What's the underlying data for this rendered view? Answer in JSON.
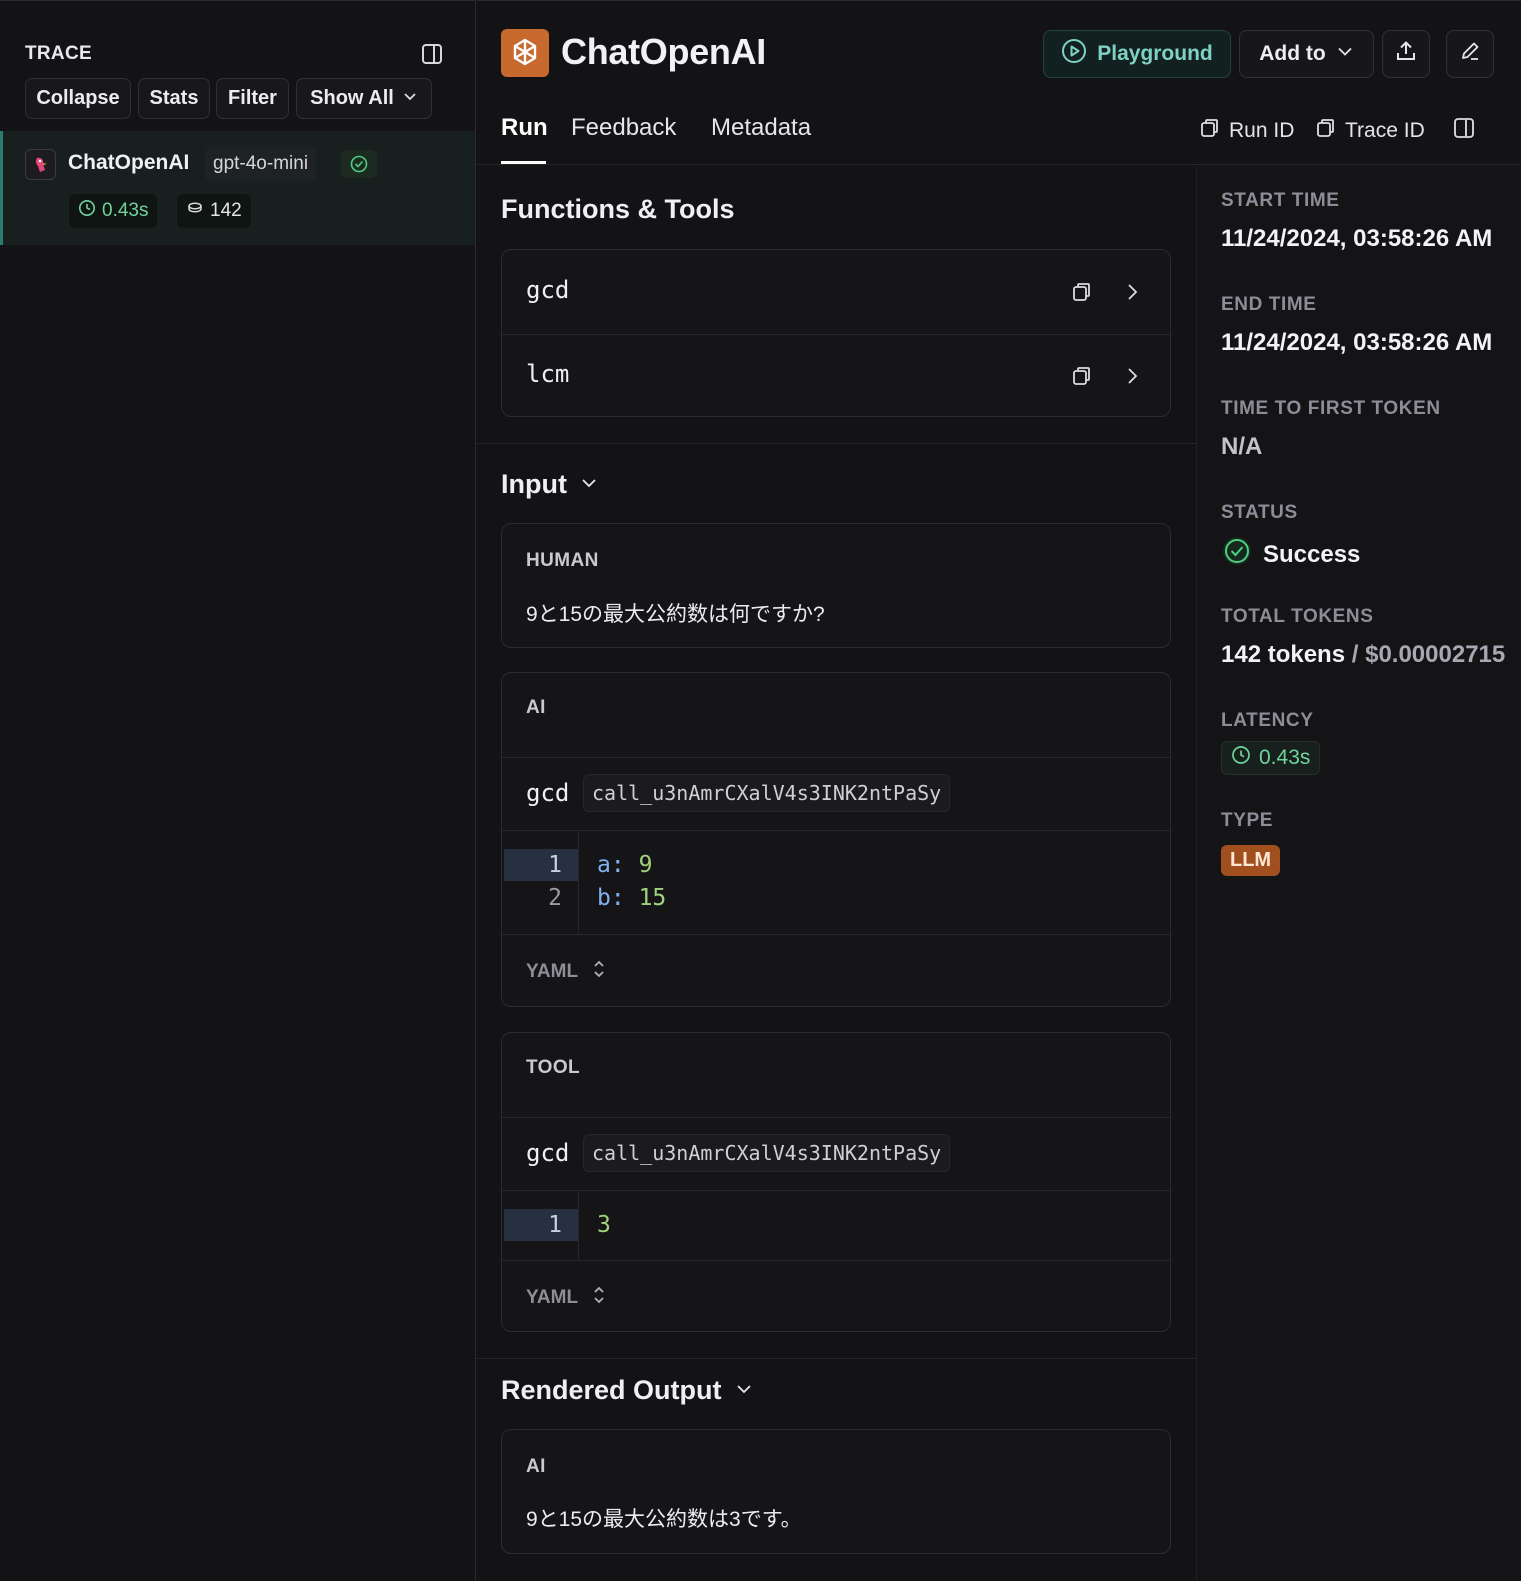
{
  "trace": {
    "title": "TRACE",
    "toolbar": {
      "collapse": "Collapse",
      "stats": "Stats",
      "filter": "Filter",
      "show_all": "Show All"
    },
    "run": {
      "name": "ChatOpenAI",
      "model": "gpt-4o-mini",
      "status_icon": "check-circle-icon",
      "latency": "0.43s",
      "tokens": "142"
    }
  },
  "header": {
    "title": "ChatOpenAI",
    "logo_icon": "openai-logo",
    "playground": "Playground",
    "add_to": "Add to",
    "tabs": [
      "Run",
      "Feedback",
      "Metadata"
    ],
    "run_id": "Run ID",
    "trace_id": "Trace ID"
  },
  "functions": {
    "title": "Functions & Tools",
    "items": [
      {
        "name": "gcd"
      },
      {
        "name": "lcm"
      }
    ]
  },
  "input": {
    "title": "Input",
    "human": {
      "role": "HUMAN",
      "text": "9と15の最大公約数は何ですか?"
    },
    "ai": {
      "role": "AI",
      "call_name": "gcd",
      "call_id": "call_u3nAmrCXalV4s3INK2ntPaSy",
      "lines": [
        {
          "num": "1",
          "key": "a:",
          "val": "9"
        },
        {
          "num": "2",
          "key": "b:",
          "val": "15"
        }
      ],
      "format": "YAML"
    },
    "tool": {
      "role": "TOOL",
      "call_name": "gcd",
      "call_id": "call_u3nAmrCXalV4s3INK2ntPaSy",
      "lines": [
        {
          "num": "1",
          "val": "3"
        }
      ],
      "format": "YAML"
    }
  },
  "output": {
    "title": "Rendered Output",
    "ai": {
      "role": "AI",
      "text": "9と15の最大公約数は3です。"
    }
  },
  "meta": {
    "start_label": "START TIME",
    "start_value": "11/24/2024, 03:58:26 AM",
    "end_label": "END TIME",
    "end_value": "11/24/2024, 03:58:26 AM",
    "ttft_label": "TIME TO FIRST TOKEN",
    "ttft_value": "N/A",
    "status_label": "STATUS",
    "status_value": "Success",
    "tokens_label": "TOTAL TOKENS",
    "tokens_value": "142 tokens",
    "tokens_sep": " / ",
    "cost_value": "$0.00002715",
    "latency_label": "LATENCY",
    "latency_value": "0.43s",
    "type_label": "TYPE",
    "type_value": "LLM"
  },
  "colors": {
    "accent": "#7fd1c4",
    "success": "#4ccf7f",
    "llm_badge": "#a14f1e",
    "logo": "#c8692e"
  }
}
